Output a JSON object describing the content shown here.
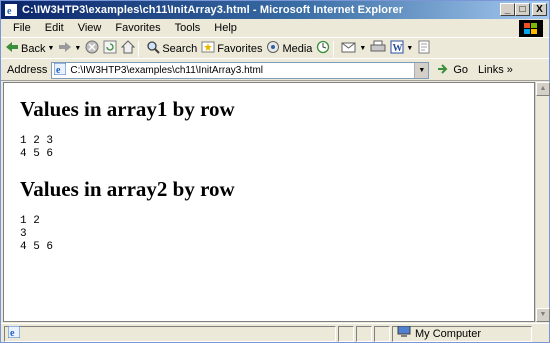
{
  "window": {
    "title": "C:\\IW3HTP3\\examples\\ch11\\InitArray3.html - Microsoft Internet Explorer",
    "min_label": "_",
    "max_label": "□",
    "close_label": "X"
  },
  "menu": {
    "items": [
      "File",
      "Edit",
      "View",
      "Favorites",
      "Tools",
      "Help"
    ]
  },
  "toolbar": {
    "back_label": "Back",
    "search_label": "Search",
    "favorites_label": "Favorites",
    "media_label": "Media"
  },
  "address": {
    "label": "Address",
    "url": "C:\\IW3HTP3\\examples\\ch11\\InitArray3.html",
    "go_label": "Go",
    "links_label": "Links »"
  },
  "page": {
    "heading1": "Values in array1 by row",
    "array1_rows": "1 2 3\n4 5 6",
    "heading2": "Values in array2 by row",
    "array2_rows": "1 2\n3\n4 5 6"
  },
  "status": {
    "zone_label": "My Computer"
  },
  "colors": {
    "title_start": "#0a246a",
    "title_end": "#a6caf0",
    "chrome": "#ece9d8"
  }
}
